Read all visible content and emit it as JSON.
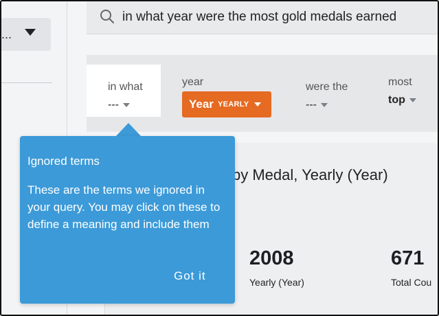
{
  "search": {
    "query": "in what year were the most gold medals earned",
    "icon": "search-icon"
  },
  "sidebar": {
    "select_value": "..."
  },
  "tokens": [
    {
      "label": "in what",
      "value": "---"
    },
    {
      "label": "year",
      "value": "Year",
      "sub": "YEARLY"
    },
    {
      "label": "were the",
      "value": "---"
    },
    {
      "label": "most",
      "value": "top"
    }
  ],
  "result": {
    "title": "by Medal, Yearly (Year)",
    "kpis": [
      {
        "value": "2008",
        "label": "Yearly (Year)"
      },
      {
        "value": "671",
        "label": "Total Cou"
      }
    ]
  },
  "tooltip": {
    "heading": "Ignored terms",
    "body": "These are the terms we ignored in your query. You may click on these to define a meaning and include them",
    "button": "Got it"
  },
  "colors": {
    "accent_orange": "#e56a22",
    "tooltip_blue": "#3c9ad8"
  }
}
